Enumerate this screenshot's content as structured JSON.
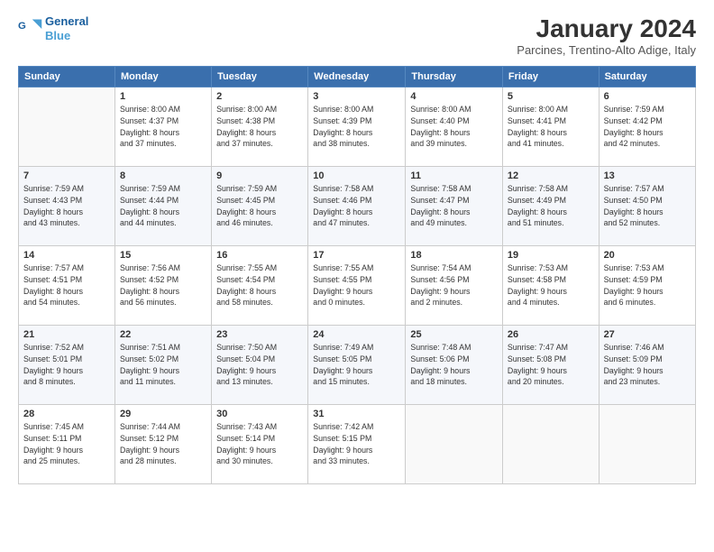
{
  "logo": {
    "line1": "General",
    "line2": "Blue"
  },
  "title": "January 2024",
  "subtitle": "Parcines, Trentino-Alto Adige, Italy",
  "days_header": [
    "Sunday",
    "Monday",
    "Tuesday",
    "Wednesday",
    "Thursday",
    "Friday",
    "Saturday"
  ],
  "weeks": [
    [
      {
        "day": "",
        "info": ""
      },
      {
        "day": "1",
        "info": "Sunrise: 8:00 AM\nSunset: 4:37 PM\nDaylight: 8 hours\nand 37 minutes."
      },
      {
        "day": "2",
        "info": "Sunrise: 8:00 AM\nSunset: 4:38 PM\nDaylight: 8 hours\nand 37 minutes."
      },
      {
        "day": "3",
        "info": "Sunrise: 8:00 AM\nSunset: 4:39 PM\nDaylight: 8 hours\nand 38 minutes."
      },
      {
        "day": "4",
        "info": "Sunrise: 8:00 AM\nSunset: 4:40 PM\nDaylight: 8 hours\nand 39 minutes."
      },
      {
        "day": "5",
        "info": "Sunrise: 8:00 AM\nSunset: 4:41 PM\nDaylight: 8 hours\nand 41 minutes."
      },
      {
        "day": "6",
        "info": "Sunrise: 7:59 AM\nSunset: 4:42 PM\nDaylight: 8 hours\nand 42 minutes."
      }
    ],
    [
      {
        "day": "7",
        "info": "Sunrise: 7:59 AM\nSunset: 4:43 PM\nDaylight: 8 hours\nand 43 minutes."
      },
      {
        "day": "8",
        "info": "Sunrise: 7:59 AM\nSunset: 4:44 PM\nDaylight: 8 hours\nand 44 minutes."
      },
      {
        "day": "9",
        "info": "Sunrise: 7:59 AM\nSunset: 4:45 PM\nDaylight: 8 hours\nand 46 minutes."
      },
      {
        "day": "10",
        "info": "Sunrise: 7:58 AM\nSunset: 4:46 PM\nDaylight: 8 hours\nand 47 minutes."
      },
      {
        "day": "11",
        "info": "Sunrise: 7:58 AM\nSunset: 4:47 PM\nDaylight: 8 hours\nand 49 minutes."
      },
      {
        "day": "12",
        "info": "Sunrise: 7:58 AM\nSunset: 4:49 PM\nDaylight: 8 hours\nand 51 minutes."
      },
      {
        "day": "13",
        "info": "Sunrise: 7:57 AM\nSunset: 4:50 PM\nDaylight: 8 hours\nand 52 minutes."
      }
    ],
    [
      {
        "day": "14",
        "info": "Sunrise: 7:57 AM\nSunset: 4:51 PM\nDaylight: 8 hours\nand 54 minutes."
      },
      {
        "day": "15",
        "info": "Sunrise: 7:56 AM\nSunset: 4:52 PM\nDaylight: 8 hours\nand 56 minutes."
      },
      {
        "day": "16",
        "info": "Sunrise: 7:55 AM\nSunset: 4:54 PM\nDaylight: 8 hours\nand 58 minutes."
      },
      {
        "day": "17",
        "info": "Sunrise: 7:55 AM\nSunset: 4:55 PM\nDaylight: 9 hours\nand 0 minutes."
      },
      {
        "day": "18",
        "info": "Sunrise: 7:54 AM\nSunset: 4:56 PM\nDaylight: 9 hours\nand 2 minutes."
      },
      {
        "day": "19",
        "info": "Sunrise: 7:53 AM\nSunset: 4:58 PM\nDaylight: 9 hours\nand 4 minutes."
      },
      {
        "day": "20",
        "info": "Sunrise: 7:53 AM\nSunset: 4:59 PM\nDaylight: 9 hours\nand 6 minutes."
      }
    ],
    [
      {
        "day": "21",
        "info": "Sunrise: 7:52 AM\nSunset: 5:01 PM\nDaylight: 9 hours\nand 8 minutes."
      },
      {
        "day": "22",
        "info": "Sunrise: 7:51 AM\nSunset: 5:02 PM\nDaylight: 9 hours\nand 11 minutes."
      },
      {
        "day": "23",
        "info": "Sunrise: 7:50 AM\nSunset: 5:04 PM\nDaylight: 9 hours\nand 13 minutes."
      },
      {
        "day": "24",
        "info": "Sunrise: 7:49 AM\nSunset: 5:05 PM\nDaylight: 9 hours\nand 15 minutes."
      },
      {
        "day": "25",
        "info": "Sunrise: 7:48 AM\nSunset: 5:06 PM\nDaylight: 9 hours\nand 18 minutes."
      },
      {
        "day": "26",
        "info": "Sunrise: 7:47 AM\nSunset: 5:08 PM\nDaylight: 9 hours\nand 20 minutes."
      },
      {
        "day": "27",
        "info": "Sunrise: 7:46 AM\nSunset: 5:09 PM\nDaylight: 9 hours\nand 23 minutes."
      }
    ],
    [
      {
        "day": "28",
        "info": "Sunrise: 7:45 AM\nSunset: 5:11 PM\nDaylight: 9 hours\nand 25 minutes."
      },
      {
        "day": "29",
        "info": "Sunrise: 7:44 AM\nSunset: 5:12 PM\nDaylight: 9 hours\nand 28 minutes."
      },
      {
        "day": "30",
        "info": "Sunrise: 7:43 AM\nSunset: 5:14 PM\nDaylight: 9 hours\nand 30 minutes."
      },
      {
        "day": "31",
        "info": "Sunrise: 7:42 AM\nSunset: 5:15 PM\nDaylight: 9 hours\nand 33 minutes."
      },
      {
        "day": "",
        "info": ""
      },
      {
        "day": "",
        "info": ""
      },
      {
        "day": "",
        "info": ""
      }
    ]
  ]
}
